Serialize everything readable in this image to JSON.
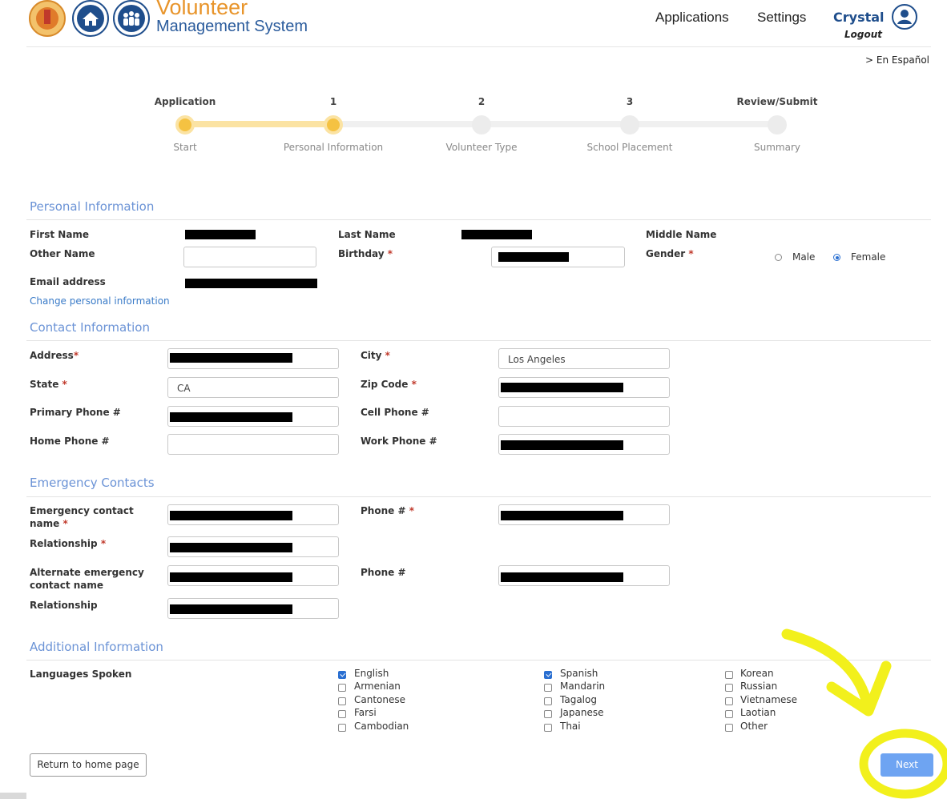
{
  "header": {
    "brand_line1": "Volunteer",
    "brand_line2": "Management System",
    "nav": {
      "applications": "Applications",
      "settings": "Settings"
    },
    "user_name": "Crystal",
    "logout": "Logout",
    "language_link": "> En Español"
  },
  "stepper": {
    "steps": [
      {
        "label": "Application",
        "sub": "Start",
        "state": "complete"
      },
      {
        "label": "1",
        "sub": "Personal Information",
        "state": "current"
      },
      {
        "label": "2",
        "sub": "Volunteer Type",
        "state": "upcoming"
      },
      {
        "label": "3",
        "sub": "School Placement",
        "state": "upcoming"
      },
      {
        "label": "Review/Submit",
        "sub": "Summary",
        "state": "upcoming"
      }
    ],
    "active_color": "#f5c242"
  },
  "personal": {
    "title": "Personal Information",
    "first_name_label": "First Name",
    "last_name_label": "Last Name",
    "middle_name_label": "Middle Name",
    "other_name_label": "Other Name",
    "other_name_value": "",
    "birthday_label": "Birthday",
    "gender_label": "Gender",
    "gender_options": [
      "Male",
      "Female"
    ],
    "gender_selected": "Female",
    "email_label": "Email address",
    "change_link": "Change personal information"
  },
  "contact": {
    "title": "Contact Information",
    "address_label": "Address",
    "city_label": "City",
    "city_value": "Los Angeles",
    "state_label": "State",
    "state_value": "CA",
    "zip_label": "Zip Code",
    "primary_phone_label": "Primary Phone #",
    "cell_phone_label": "Cell Phone #",
    "cell_phone_value": "",
    "home_phone_label": "Home Phone #",
    "home_phone_value": "",
    "work_phone_label": "Work Phone #"
  },
  "emergency": {
    "title": "Emergency Contacts",
    "contact_name_label_1": "Emergency contact",
    "contact_name_label_2": "name",
    "phone_label": "Phone #",
    "relationship_label": "Relationship",
    "alt_name_label_1": "Alternate emergency",
    "alt_name_label_2": "contact name",
    "alt_phone_label": "Phone #",
    "alt_relationship_label": "Relationship"
  },
  "additional": {
    "title": "Additional Information",
    "languages_label": "Languages Spoken",
    "languages": [
      {
        "name": "English",
        "checked": true
      },
      {
        "name": "Armenian",
        "checked": false
      },
      {
        "name": "Cantonese",
        "checked": false
      },
      {
        "name": "Farsi",
        "checked": false
      },
      {
        "name": "Cambodian",
        "checked": false
      },
      {
        "name": "Spanish",
        "checked": true
      },
      {
        "name": "Mandarin",
        "checked": false
      },
      {
        "name": "Tagalog",
        "checked": false
      },
      {
        "name": "Japanese",
        "checked": false
      },
      {
        "name": "Thai",
        "checked": false
      },
      {
        "name": "Korean",
        "checked": false
      },
      {
        "name": "Russian",
        "checked": false
      },
      {
        "name": "Vietnamese",
        "checked": false
      },
      {
        "name": "Laotian",
        "checked": false
      },
      {
        "name": "Other",
        "checked": false
      }
    ]
  },
  "footer": {
    "return_button": "Return to home page",
    "next_button": "Next"
  },
  "annotation_color": "#f2f01c"
}
